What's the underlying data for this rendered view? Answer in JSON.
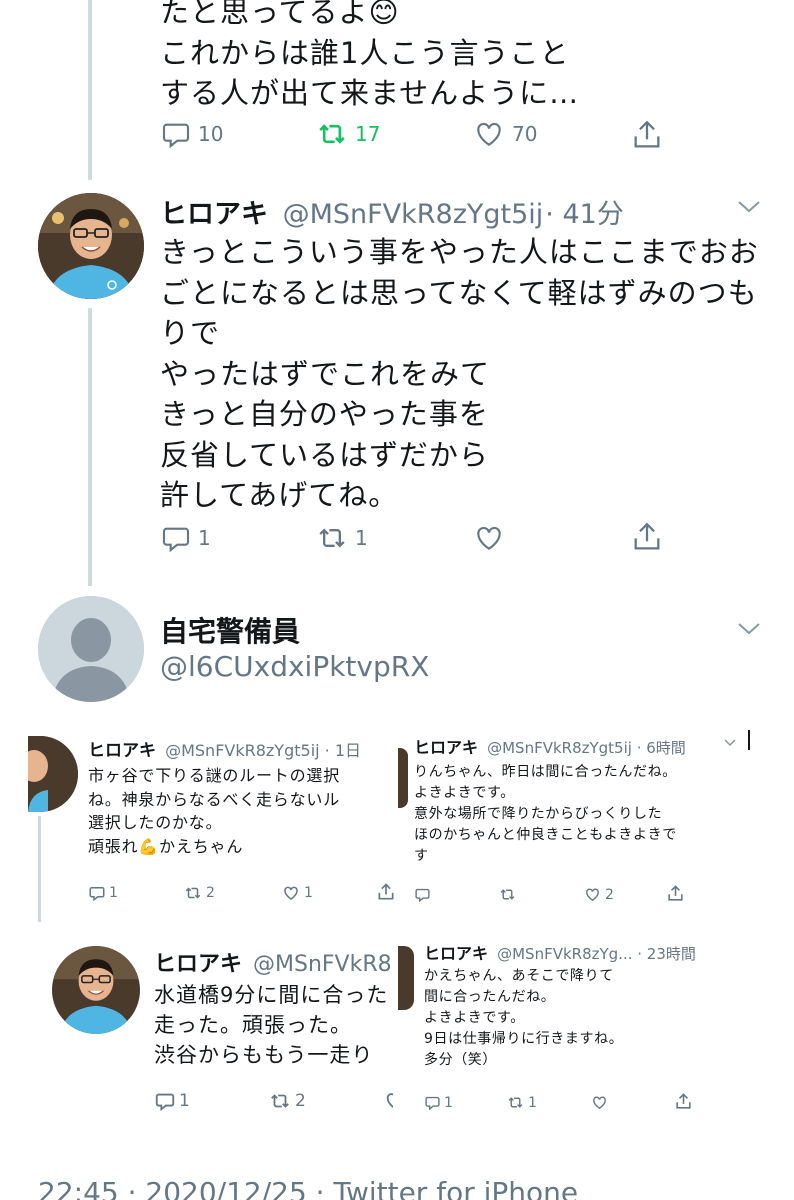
{
  "tweet1": {
    "lines": [
      "たと思ってるよ😊",
      "これからは誰1人こう言うこと",
      "する人が出て来ませんように…"
    ],
    "replies": "10",
    "retweets": "17",
    "likes": "70"
  },
  "tweet2": {
    "name": "ヒロアキ",
    "handle": "@MSnFVkR8zYgt5ij",
    "time": "· 41分",
    "lines": [
      "きっとこういう事をやった人はここまでおお",
      "ごとになるとは思ってなくて軽はずみのつも",
      "りで",
      "やったはずでこれをみて",
      "きっと自分のやった事を",
      "反省しているはずだから",
      "許してあげてね。"
    ],
    "replies": "1",
    "retweets": "1",
    "likes": ""
  },
  "tweet3": {
    "name": "自宅警備員",
    "handle": "@l6CUxdxiPktvpRX"
  },
  "shot1": {
    "name": "ヒロアキ",
    "handle": "@MSnFVkR8zYgt5ij · 1日",
    "lines": [
      "市ヶ谷で下りる謎のルートの選択",
      "ね。神泉からなるべく走らないル",
      "選択したのかな。",
      "頑張れ💪かえちゃん"
    ],
    "replies": "1",
    "retweets": "2",
    "likes": "1"
  },
  "shot2": {
    "name": "ヒロアキ",
    "handle": "@MSnFVkR8zYgt5ij · 6時間",
    "lines": [
      "りんちゃん、昨日は間に合ったんだね。",
      "よきよきです。",
      "意外な場所で降りたからびっくりした",
      "ほのかちゃんと仲良きこともよきよきで",
      "す"
    ],
    "replies": "",
    "retweets": "",
    "likes": "2"
  },
  "shot3": {
    "name": "ヒロアキ",
    "handle": "@MSnFVkR8",
    "lines": [
      "水道橋9分に間に合った",
      "走った。頑張った。",
      "渋谷からももう一走り"
    ],
    "replies": "1",
    "retweets": "2"
  },
  "shot4": {
    "name": "ヒロアキ",
    "handle": "@MSnFVkR8zYg... · 23時間",
    "lines": [
      "かえちゃん、あそこで降りて",
      "間に合ったんだね。",
      "よきよきです。",
      "9日は仕事帰りに行きますね。",
      "多分（笑）"
    ],
    "replies": "1",
    "retweets": "1"
  },
  "footer": {
    "partial": "22:45 · 2020/12/25 · Twitter for iPhone"
  },
  "colors": {
    "retweet_active": "#17bf63",
    "muted": "#657786",
    "thread": "#cfd9de",
    "tshirt": "#4fb6e3"
  }
}
